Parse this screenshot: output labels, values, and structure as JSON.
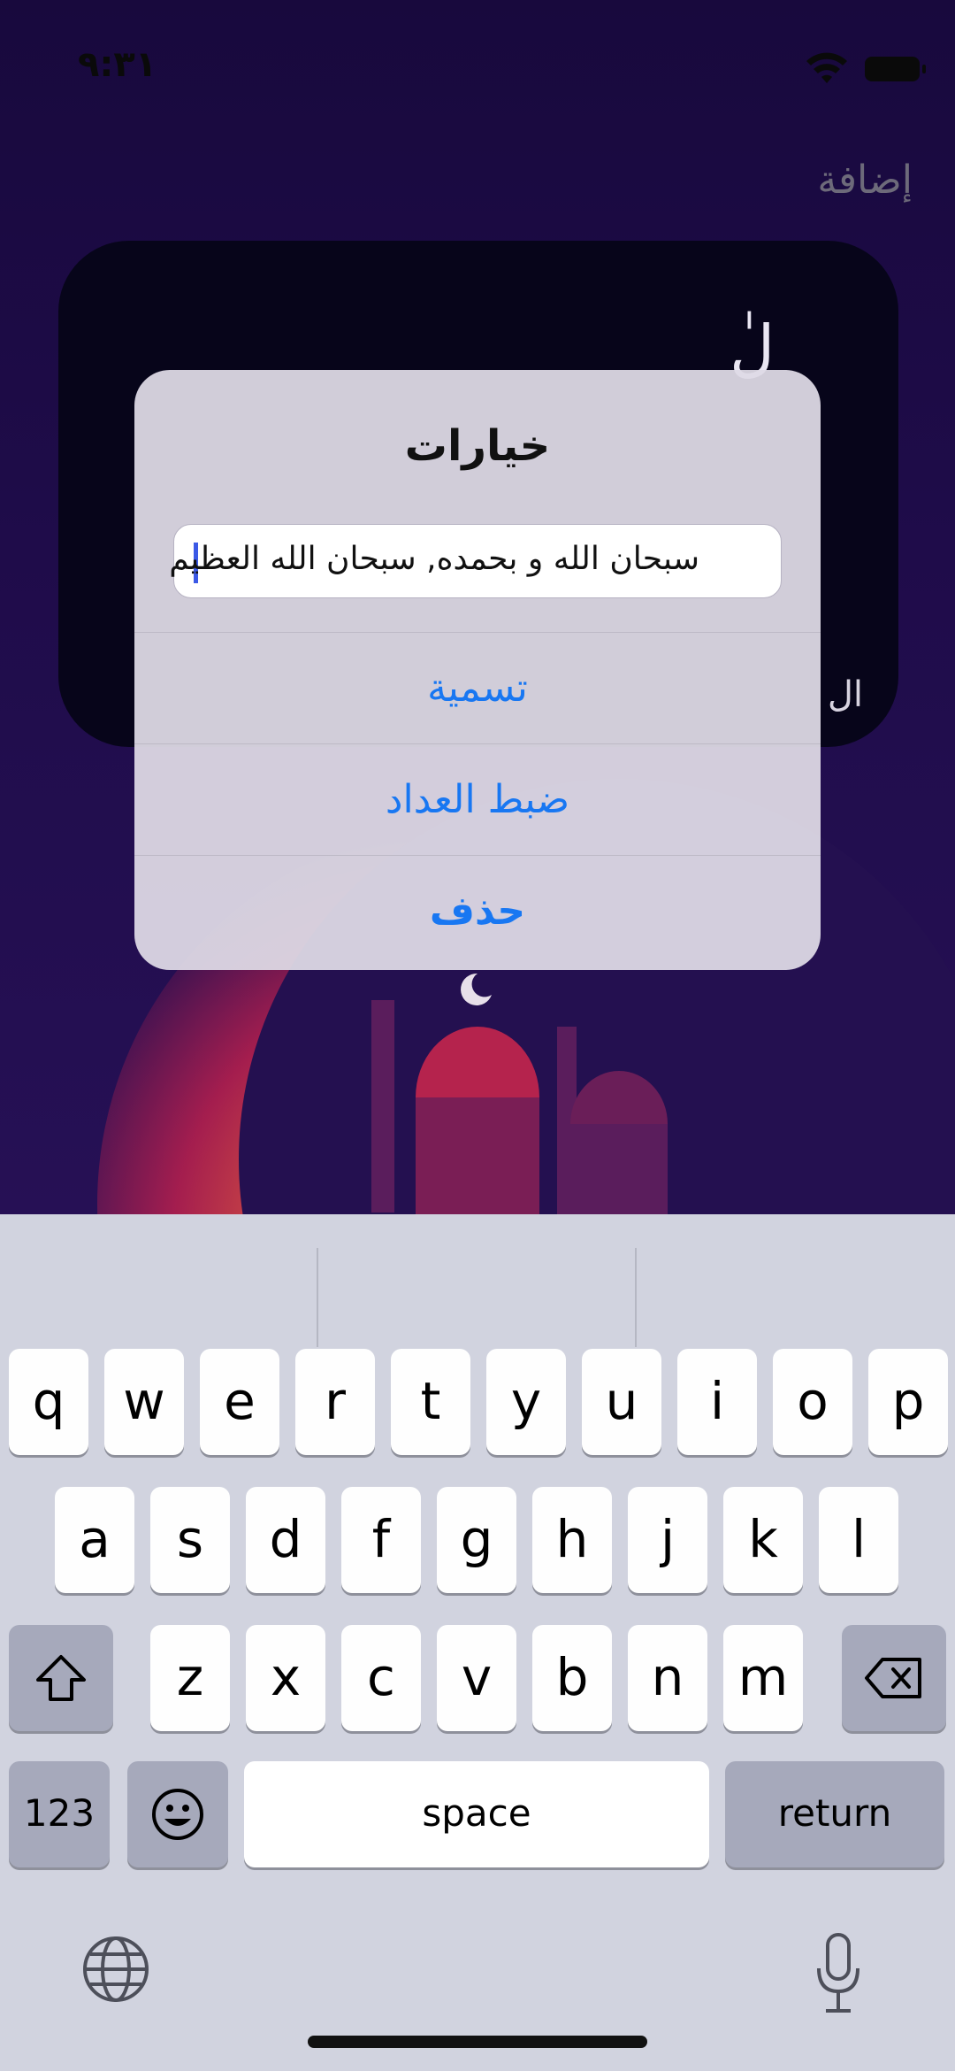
{
  "status": {
    "time": "٩:٣١"
  },
  "nav": {
    "add_label": "إضافة"
  },
  "card": {
    "glyph": "لٰ",
    "side_text": "ال"
  },
  "alert": {
    "title": "خيارات",
    "input_value": "سبحان الله و بحمده, سبحان الله العظيم",
    "buttons": [
      "تسمية",
      "ضبط العداد",
      "حذف"
    ]
  },
  "keyboard": {
    "row1": [
      "q",
      "w",
      "e",
      "r",
      "t",
      "y",
      "u",
      "i",
      "o",
      "p"
    ],
    "row2": [
      "a",
      "s",
      "d",
      "f",
      "g",
      "h",
      "j",
      "k",
      "l"
    ],
    "row3": [
      "z",
      "x",
      "c",
      "v",
      "b",
      "n",
      "m"
    ],
    "num_label": "123",
    "space_label": "space",
    "return_label": "return"
  },
  "colors": {
    "accent": "#1877f2",
    "keyboard_bg": "#d1d3df",
    "background": "#1f0c4a"
  }
}
